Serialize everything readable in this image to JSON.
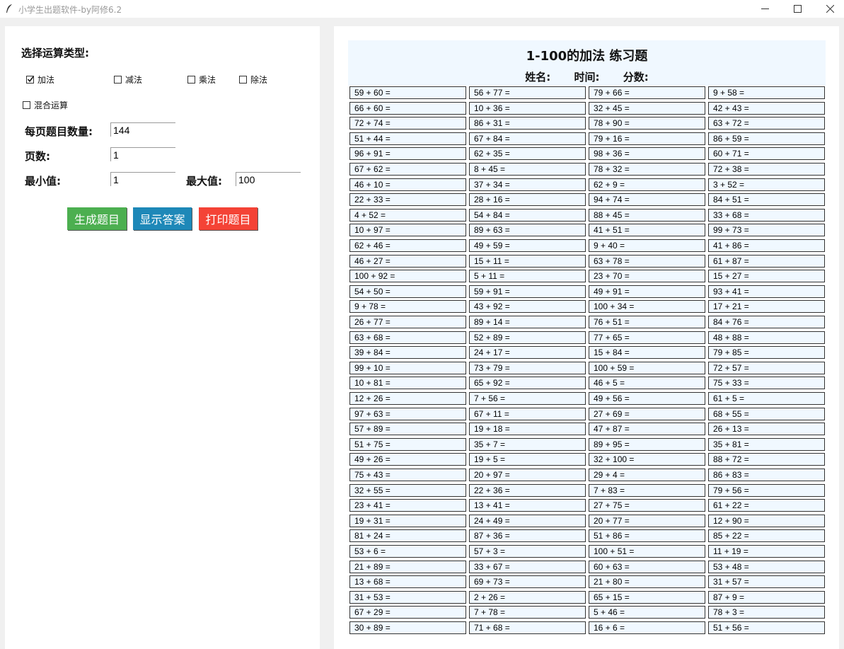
{
  "window": {
    "title": "小学生出题软件-by阿修6.2",
    "icon": "feather-icon",
    "controls": [
      "minimize-icon",
      "maximize-icon",
      "close-icon"
    ]
  },
  "left": {
    "op_heading": "选择运算类型:",
    "ops": [
      {
        "label": "加法",
        "checked": true
      },
      {
        "label": "减法",
        "checked": false
      },
      {
        "label": "乘法",
        "checked": false
      },
      {
        "label": "除法",
        "checked": false
      },
      {
        "label": "混合运算",
        "checked": false
      }
    ],
    "per_page_label": "每页题目数量:",
    "per_page_value": "144",
    "pages_label": "页数:",
    "pages_value": "1",
    "min_label": "最小值:",
    "min_value": "1",
    "max_label": "最大值:",
    "max_value": "100",
    "buttons": {
      "generate": "生成题目",
      "show_answers": "显示答案",
      "print": "打印题目"
    }
  },
  "sheet": {
    "title": "1-100的加法 练习题",
    "name_label": "姓名:",
    "time_label": "时间:",
    "score_label": "分数:",
    "problems": [
      [
        "59 + 60 =",
        "56 + 77 =",
        "79 + 66 =",
        "9 + 58 ="
      ],
      [
        "66 + 60 =",
        "10 + 36 =",
        "32 + 45 =",
        "42 + 43 ="
      ],
      [
        "72 + 74 =",
        "86 + 31 =",
        "78 + 90 =",
        "63 + 72 ="
      ],
      [
        "51 + 44 =",
        "67 + 84 =",
        "79 + 16 =",
        "86 + 59 ="
      ],
      [
        "96 + 91 =",
        "62 + 35 =",
        "98 + 36 =",
        "60 + 71 ="
      ],
      [
        "67 + 62 =",
        "8 + 45 =",
        "78 + 32 =",
        "72 + 38 ="
      ],
      [
        "46 + 10 =",
        "37 + 34 =",
        "62 + 9 =",
        "3 + 52 ="
      ],
      [
        "22 + 33 =",
        "28 + 16 =",
        "94 + 74 =",
        "84 + 51 ="
      ],
      [
        "4 + 52 =",
        "54 + 84 =",
        "88 + 45 =",
        "33 + 68 ="
      ],
      [
        "10 + 97 =",
        "89 + 63 =",
        "41 + 51 =",
        "99 + 73 ="
      ],
      [
        "62 + 46 =",
        "49 + 59 =",
        "9 + 40 =",
        "41 + 86 ="
      ],
      [
        "46 + 27 =",
        "15 + 11 =",
        "63 + 78 =",
        "61 + 87 ="
      ],
      [
        "100 + 92 =",
        "5 + 11 =",
        "23 + 70 =",
        "15 + 27 ="
      ],
      [
        "54 + 50 =",
        "59 + 91 =",
        "49 + 91 =",
        "93 + 41 ="
      ],
      [
        "9 + 78 =",
        "43 + 92 =",
        "100 + 34 =",
        "17 + 21 ="
      ],
      [
        "26 + 77 =",
        "89 + 14 =",
        "76 + 51 =",
        "84 + 76 ="
      ],
      [
        "63 + 68 =",
        "52 + 89 =",
        "77 + 65 =",
        "48 + 88 ="
      ],
      [
        "39 + 84 =",
        "24 + 17 =",
        "15 + 84 =",
        "79 + 85 ="
      ],
      [
        "99 + 10 =",
        "73 + 79 =",
        "100 + 59 =",
        "72 + 57 ="
      ],
      [
        "10 + 81 =",
        "65 + 92 =",
        "46 + 5 =",
        "75 + 33 ="
      ],
      [
        "12 + 26 =",
        "7 + 56 =",
        "49 + 56 =",
        "61 + 5 ="
      ],
      [
        "97 + 63 =",
        "67 + 11 =",
        "27 + 69 =",
        "68 + 55 ="
      ],
      [
        "57 + 89 =",
        "19 + 18 =",
        "47 + 87 =",
        "26 + 13 ="
      ],
      [
        "51 + 75 =",
        "35 + 7 =",
        "89 + 95 =",
        "35 + 81 ="
      ],
      [
        "49 + 26 =",
        "19 + 5 =",
        "32 + 100 =",
        "88 + 72 ="
      ],
      [
        "75 + 43 =",
        "20 + 97 =",
        "29 + 4 =",
        "86 + 83 ="
      ],
      [
        "32 + 55 =",
        "22 + 36 =",
        "7 + 83 =",
        "79 + 56 ="
      ],
      [
        "23 + 41 =",
        "13 + 41 =",
        "27 + 75 =",
        "61 + 22 ="
      ],
      [
        "19 + 31 =",
        "24 + 49 =",
        "20 + 77 =",
        "12 + 90 ="
      ],
      [
        "81 + 24 =",
        "87 + 36 =",
        "51 + 86 =",
        "85 + 22 ="
      ],
      [
        "53 + 6 =",
        "57 + 3 =",
        "100 + 51 =",
        "11 + 19 ="
      ],
      [
        "21 + 89 =",
        "33 + 67 =",
        "60 + 63 =",
        "53 + 48 ="
      ],
      [
        "13 + 68 =",
        "69 + 73 =",
        "21 + 80 =",
        "31 + 57 ="
      ],
      [
        "31 + 53 =",
        "2 + 26 =",
        "65 + 15 =",
        "87 + 9 ="
      ],
      [
        "67 + 29 =",
        "7 + 78 =",
        "5 + 46 =",
        "78 + 3 ="
      ],
      [
        "30 + 89 =",
        "71 + 68 =",
        "16 + 6 =",
        "51 + 56 ="
      ]
    ]
  }
}
